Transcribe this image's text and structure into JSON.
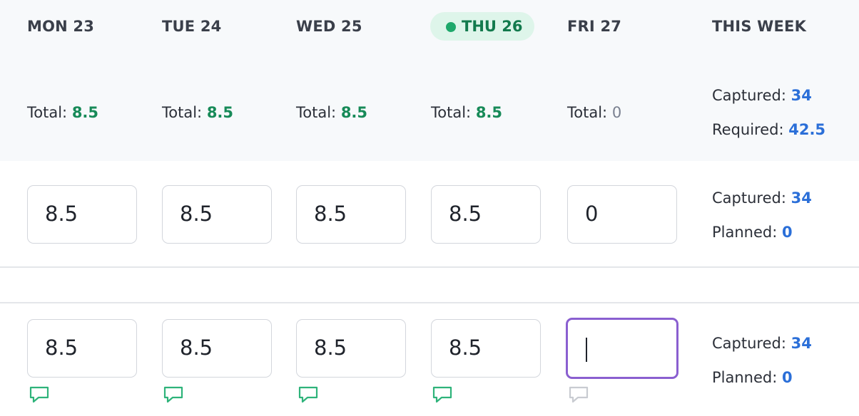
{
  "header": {
    "days": [
      {
        "label": "MON 23",
        "total_label": "Total:",
        "total_value": "8.5"
      },
      {
        "label": "TUE 24",
        "total_label": "Total:",
        "total_value": "8.5"
      },
      {
        "label": "WED 25",
        "total_label": "Total:",
        "total_value": "8.5"
      },
      {
        "label": "THU 26",
        "total_label": "Total:",
        "total_value": "8.5",
        "is_today": true
      },
      {
        "label": "FRI 27",
        "total_label": "Total:",
        "total_value": "0"
      }
    ],
    "week": {
      "label": "THIS WEEK",
      "captured_label": "Captured:",
      "captured_value": "34",
      "required_label": "Required:",
      "required_value": "42.5"
    }
  },
  "rows": [
    {
      "values": [
        "8.5",
        "8.5",
        "8.5",
        "8.5",
        "0"
      ],
      "captured_label": "Captured:",
      "captured_value": "34",
      "planned_label": "Planned:",
      "planned_value": "0"
    },
    {
      "values": [
        "8.5",
        "8.5",
        "8.5",
        "8.5",
        ""
      ],
      "focused_index": 4,
      "comment_icons": [
        "comment-icon",
        "comment-icon",
        "comment-icon",
        "comment-icon",
        "comment-icon"
      ],
      "comment_icon_states": [
        "active",
        "active",
        "active",
        "active",
        "inactive"
      ],
      "captured_label": "Captured:",
      "captured_value": "34",
      "planned_label": "Planned:",
      "planned_value": "0"
    }
  ],
  "colors": {
    "today_accent": "#1ea86b",
    "total_value": "#178a58",
    "summary_value": "#2b6fd8",
    "focus_border": "#8a5fd0",
    "comment_active": "#2eb37a",
    "comment_inactive": "#c8cbd1"
  }
}
